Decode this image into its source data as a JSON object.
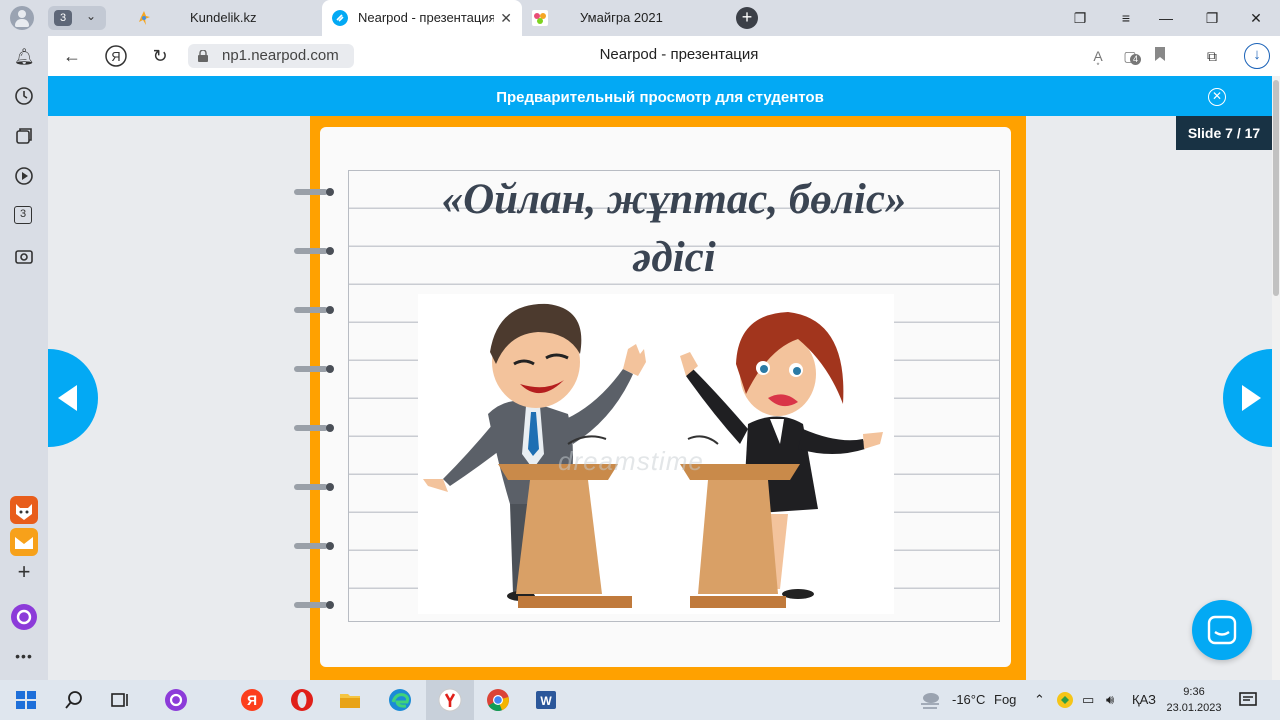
{
  "browser": {
    "tab_group_count": "3",
    "tabs": [
      {
        "title": "Kundelik.kz",
        "active": false
      },
      {
        "title": "Nearpod - презентация",
        "active": true
      },
      {
        "title": "Умайгра 2021",
        "active": false
      }
    ],
    "url": "np1.nearpod.com",
    "page_title": "Nearpod - презентация",
    "extension_badge": "4"
  },
  "sidebar": {
    "badge_count": "3"
  },
  "nearpod": {
    "banner": "Предварительный просмотр для студентов",
    "slide_indicator": "Slide 7 / 17",
    "slide": {
      "title_line1": "«Ойлан, жұптас, бөліс»",
      "title_line2": "әдісі",
      "watermark": "dreamstime"
    }
  },
  "taskbar": {
    "weather_temp": "-16°C",
    "weather_desc": "Fog",
    "language": "ҚАЗ",
    "time": "9:36",
    "date": "23.01.2023"
  },
  "colors": {
    "accent": "#03a9f4",
    "slide_frame": "#ffa100",
    "badge_bg": "#183244"
  }
}
